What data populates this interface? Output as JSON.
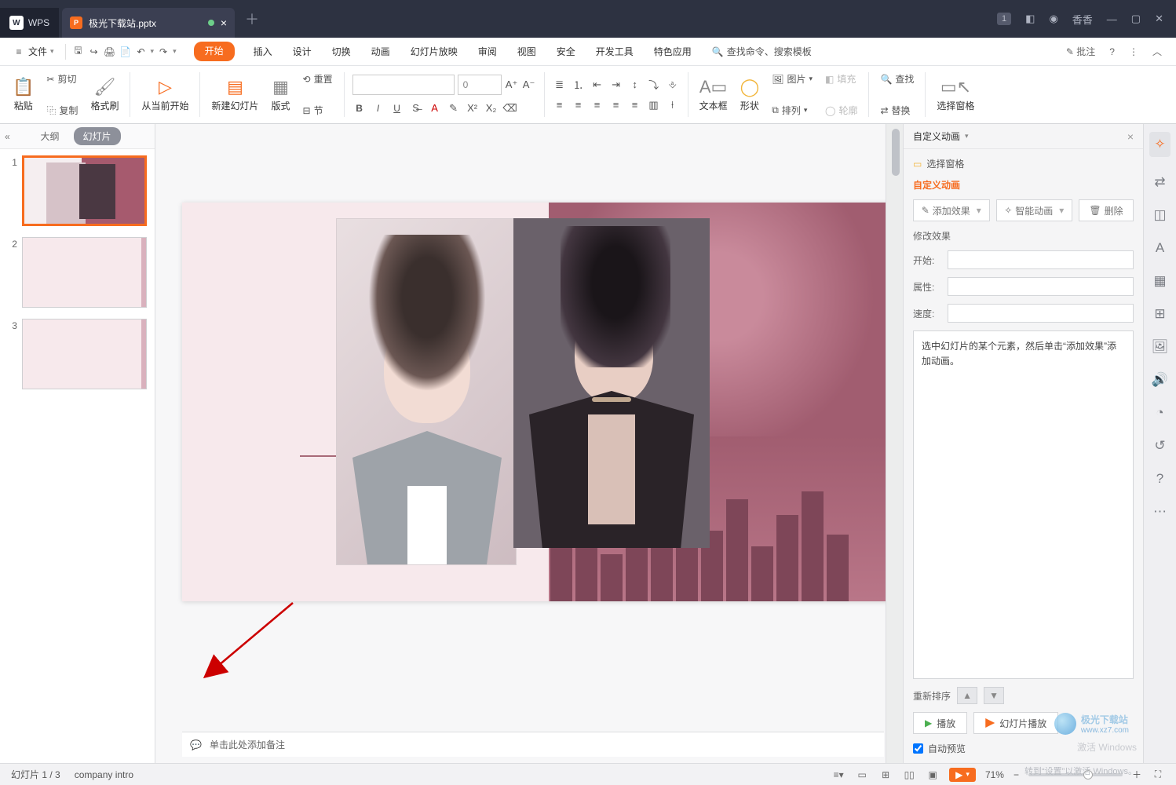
{
  "titlebar": {
    "wps": "WPS",
    "doc_name": "极光下载站.pptx",
    "badge": "1",
    "user": "香香"
  },
  "menubar": {
    "file": "文件",
    "search_placeholder": "查找命令、搜索模板",
    "tabs": [
      "开始",
      "插入",
      "设计",
      "切换",
      "动画",
      "幻灯片放映",
      "审阅",
      "视图",
      "安全",
      "开发工具",
      "特色应用"
    ],
    "pizhu": "批注"
  },
  "ribbon": {
    "paste": "粘贴",
    "cut": "剪切",
    "copy": "复制",
    "format_painter": "格式刷",
    "from_current": "从当前开始",
    "new_slide": "新建幻灯片",
    "layout": "版式",
    "section": "节",
    "reset": "重置",
    "fontsize": "0",
    "textbox": "文本框",
    "shapes": "形状",
    "picture": "图片",
    "fill": "填充",
    "arrange": "排列",
    "outline": "轮廓",
    "find": "查找",
    "replace": "替换",
    "select_pane": "选择窗格"
  },
  "slidepanel": {
    "tab_outline": "大纲",
    "tab_slides": "幻灯片",
    "nums": [
      "1",
      "2",
      "3"
    ]
  },
  "notes": {
    "placeholder": "单击此处添加备注"
  },
  "anim": {
    "title": "自定义动画",
    "select_pane": "选择窗格",
    "heading": "自定义动画",
    "add_effect": "添加效果",
    "smart_anim": "智能动画",
    "delete": "删除",
    "modify": "修改效果",
    "start": "开始:",
    "property": "属性:",
    "speed": "速度:",
    "hint": "选中幻灯片的某个元素，然后单击“添加效果”添加动画。",
    "reorder": "重新排序",
    "play": "播放",
    "slideshow": "幻灯片播放",
    "auto_preview": "自动预览"
  },
  "status": {
    "slide": "幻灯片 1 / 3",
    "context": "company intro",
    "zoom": "71%"
  },
  "watermark": {
    "line1": "激活 Windows",
    "line2": "转到“设置”以激活 Windows。",
    "site": "极光下载站",
    "url": "www.xz7.com"
  }
}
